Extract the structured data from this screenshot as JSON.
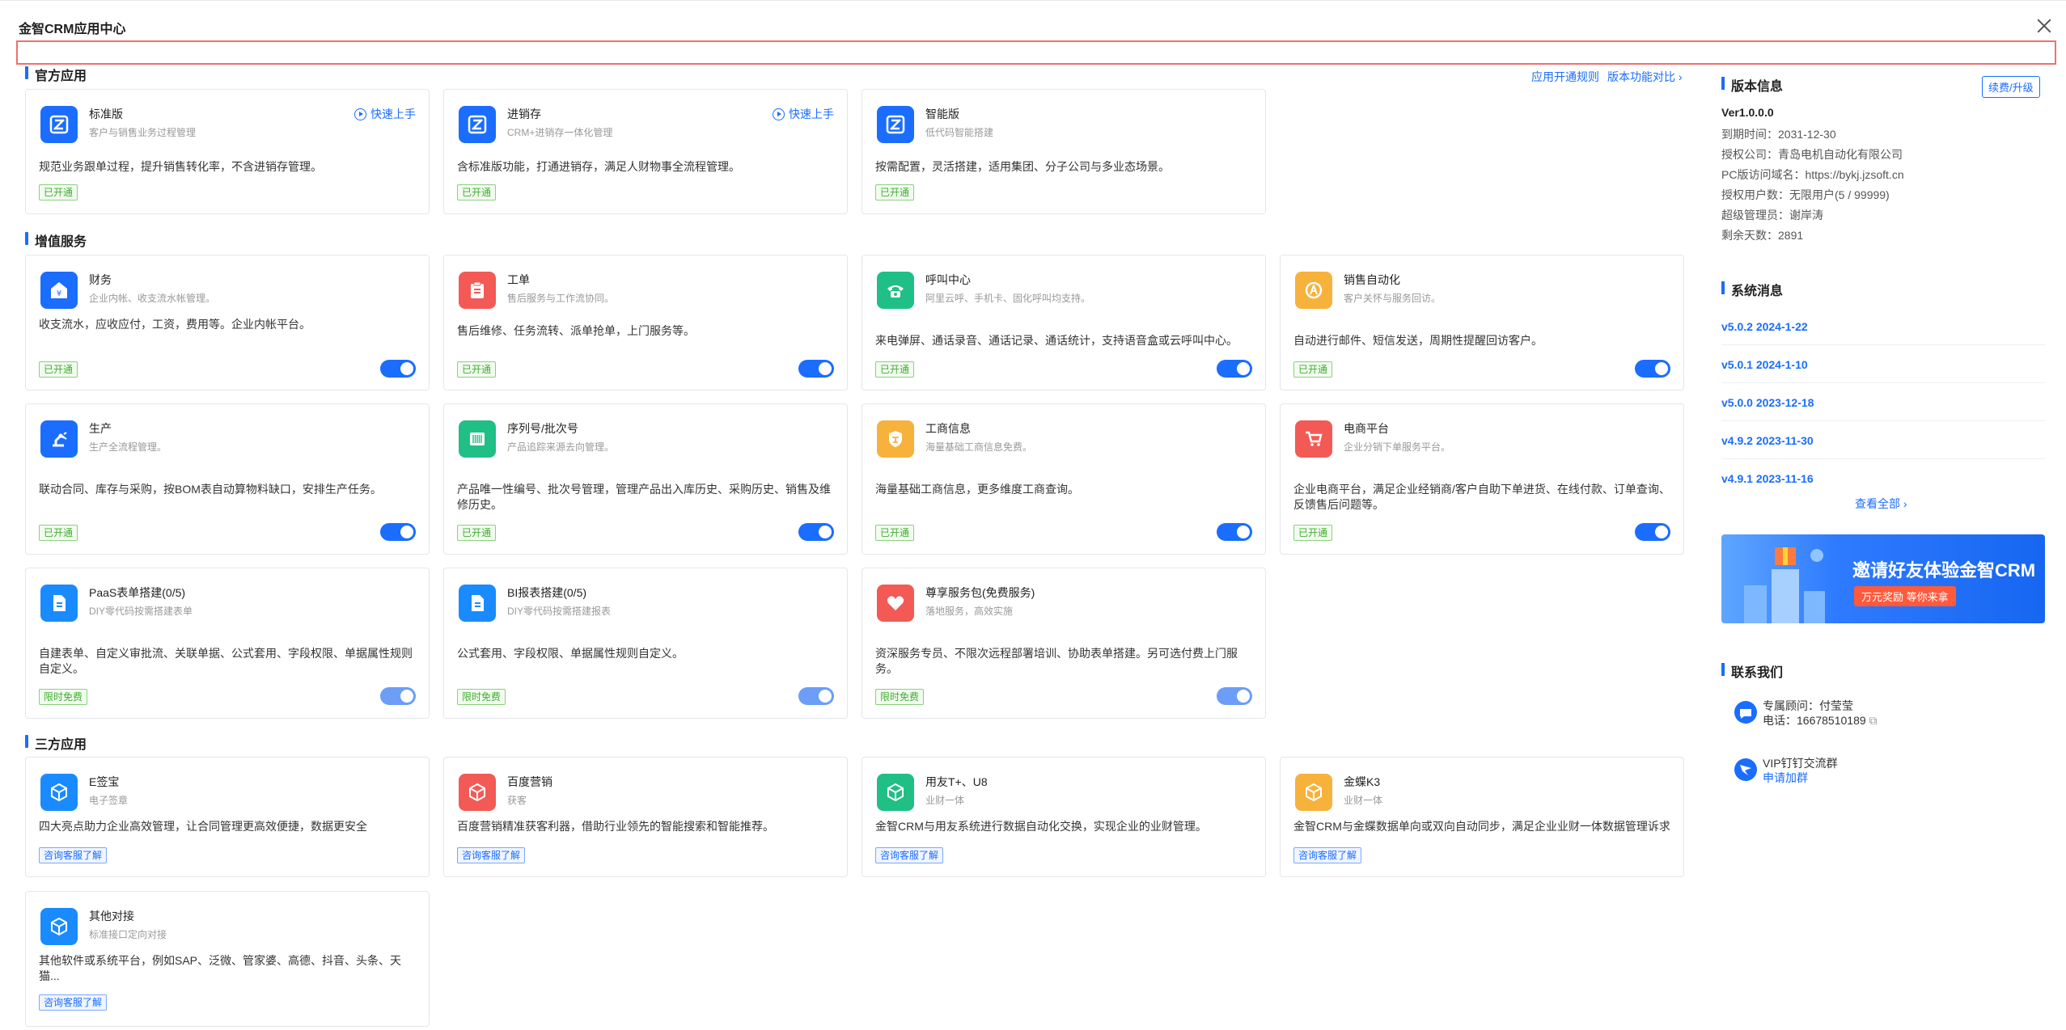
{
  "title": "金智CRM应用中心",
  "sections": {
    "official": "官方应用",
    "value_added": "增值服务",
    "third_party": "三方应用"
  },
  "top_links": {
    "rules": "应用开通规则",
    "compare": "版本功能对比"
  },
  "official_apps": [
    {
      "name": "标准版",
      "sub": "客户与销售业务过程管理",
      "desc": "规范业务跟单过程，提升销售转化率，不含进销存管理。",
      "badge": "已开通",
      "quick": "快速上手"
    },
    {
      "name": "进销存",
      "sub": "CRM+进销存一体化管理",
      "desc": "含标准版功能，打通进销存，满足人财物事全流程管理。",
      "badge": "已开通",
      "quick": "快速上手"
    },
    {
      "name": "智能版",
      "sub": "低代码智能搭建",
      "desc": "按需配置，灵活搭建，适用集团、分子公司与多业态场景。",
      "badge": "已开通"
    }
  ],
  "value_apps": [
    {
      "name": "财务",
      "sub": "企业内帐、收支流水帐管理。",
      "desc": "收支流水，应收应付，工资，费用等。企业内帐平台。",
      "badge": "已开通"
    },
    {
      "name": "工单",
      "sub": "售后服务与工作流协同。",
      "desc": "售后维修、任务流转、派单抢单，上门服务等。",
      "badge": "已开通"
    },
    {
      "name": "呼叫中心",
      "sub": "阿里云呼、手机卡、固化呼叫均支持。",
      "desc": "来电弹屏、通话录音、通话记录、通话统计，支持语音盒或云呼叫中心。",
      "badge": "已开通"
    },
    {
      "name": "销售自动化",
      "sub": "客户关怀与服务回访。",
      "desc": "自动进行邮件、短信发送，周期性提醒回访客户。",
      "badge": "已开通"
    },
    {
      "name": "生产",
      "sub": "生产全流程管理。",
      "desc": "联动合同、库存与采购，按BOM表自动算物料缺口，安排生产任务。",
      "badge": "已开通"
    },
    {
      "name": "序列号/批次号",
      "sub": "产品追踪来源去向管理。",
      "desc": "产品唯一性编号、批次号管理，管理产品出入库历史、采购历史、销售及维修历史。",
      "badge": "已开通"
    },
    {
      "name": "工商信息",
      "sub": "海量基础工商信息免费。",
      "desc": "海量基础工商信息，更多维度工商查询。",
      "badge": "已开通"
    },
    {
      "name": "电商平台",
      "sub": "企业分销下单服务平台。",
      "desc": "企业电商平台，满足企业经销商/客户自助下单进货、在线付款、订单查询、反馈售后问题等。",
      "badge": "已开通"
    },
    {
      "name": "PaaS表单搭建(0/5)",
      "sub": "DIY零代码按需搭建表单",
      "desc": "自建表单、自定义审批流、关联单据、公式套用、字段权限、单据属性规则自定义。",
      "badge": "限时免费"
    },
    {
      "name": "BI报表搭建(0/5)",
      "sub": "DIY零代码按需搭建报表",
      "desc": "公式套用、字段权限、单据属性规则自定义。",
      "badge": "限时免费"
    },
    {
      "name": "尊享服务包(免费服务)",
      "sub": "落地服务，高效实施",
      "desc": "资深服务专员、不限次远程部署培训、协助表单搭建。另可选付费上门服务。",
      "badge": "限时免费"
    }
  ],
  "third_apps": [
    {
      "name": "E签宝",
      "sub": "电子签章",
      "desc": "四大亮点助力企业高效管理，让合同管理更高效便捷，数据更安全",
      "badge": "咨询客服了解"
    },
    {
      "name": "百度营销",
      "sub": "获客",
      "desc": "百度营销精准获客利器，借助行业领先的智能搜索和智能推荐。",
      "badge": "咨询客服了解"
    },
    {
      "name": "用友T+、U8",
      "sub": "业财一体",
      "desc": "金智CRM与用友系统进行数据自动化交换，实现企业的业财管理。",
      "badge": "咨询客服了解"
    },
    {
      "name": "金蝶K3",
      "sub": "业财一体",
      "desc": "金智CRM与金蝶数据单向或双向自动同步，满足企业业财一体数据管理诉求",
      "badge": "咨询客服了解"
    },
    {
      "name": "其他对接",
      "sub": "标准接口定向对接",
      "desc": "其他软件或系统平台，例如SAP、泛微、管家婆、高德、抖音、头条、天猫...",
      "badge": "咨询客服了解"
    }
  ],
  "version": {
    "heading": "版本信息",
    "renew": "续费/升级",
    "ver": "Ver1.0.0.0",
    "expire": "到期时间：2031-12-30",
    "company": "授权公司：青岛电机自动化有限公司",
    "pc_domain": "PC版访问域名：https://bykj.jzsoft.cn",
    "users": "授权用户数：无限用户(5 / 99999)",
    "admin": "超级管理员：谢岸涛",
    "days": "剩余天数：2891"
  },
  "news": {
    "heading": "系统消息",
    "items": [
      "v5.0.2 2024-1-22",
      "v5.0.1 2024-1-10",
      "v5.0.0 2023-12-18",
      "v4.9.2 2023-11-30",
      "v4.9.1 2023-11-16"
    ],
    "see_all": "查看全部"
  },
  "banner": {
    "title": "邀请好友体验金智CRM",
    "promo": "万元奖励  等你来拿"
  },
  "contact": {
    "heading": "联系我们",
    "consultant": "专属顾问：付莹莹",
    "phone": "电话：16678510189",
    "group": "VIP钉钉交流群",
    "join": "申请加群"
  },
  "colors": {
    "accent": "#1a6dff",
    "green_badge": "#3fae2f",
    "red_icon": "#f35a55",
    "teal_icon": "#1fbf86",
    "orange_icon": "#f7b23b"
  }
}
